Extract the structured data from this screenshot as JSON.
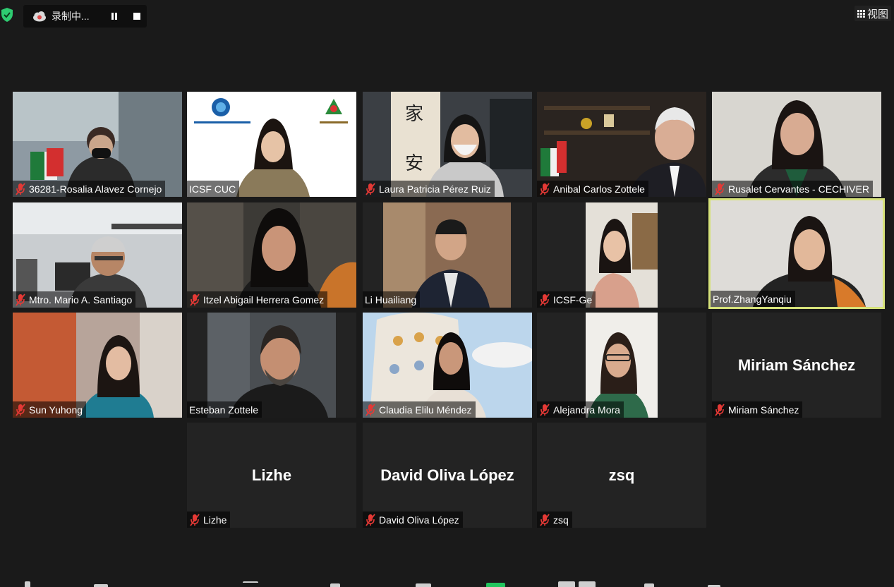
{
  "recording": {
    "label": "录制中...",
    "pause_icon": "pause-icon",
    "stop_icon": "stop-icon"
  },
  "view_button": {
    "label": "视图",
    "icon": "grid-icon"
  },
  "colors": {
    "background": "#1a1a1a",
    "tile": "#232323",
    "active_speaker": "#d6e27a",
    "mic_muted": "#e53935",
    "shield": "#2ecc71"
  },
  "participants": [
    {
      "name": "36281-Rosalia Alavez Cornejo",
      "muted": true
    },
    {
      "name": "ICSF CUC",
      "muted": false
    },
    {
      "name": "Laura Patricia Pérez Ruiz",
      "muted": true
    },
    {
      "name": "Anibal Carlos Zottele",
      "muted": true
    },
    {
      "name": "Rusalet Cervantes - CECHIVER",
      "muted": true
    },
    {
      "name": "Mtro. Mario A. Santiago",
      "muted": true
    },
    {
      "name": "Itzel Abigail Herrera Gomez",
      "muted": true
    },
    {
      "name": "Li Huailiang",
      "muted": false
    },
    {
      "name": "ICSF-Ge",
      "muted": true
    },
    {
      "name": "Prof.ZhangYanqiu",
      "muted": false,
      "active": true
    },
    {
      "name": "Sun Yuhong",
      "muted": true
    },
    {
      "name": "Esteban Zottele",
      "muted": false
    },
    {
      "name": "Claudia Elilu Méndez",
      "muted": true
    },
    {
      "name": "Alejandra Mora",
      "muted": true
    },
    {
      "name": "Miriam Sánchez",
      "muted": true,
      "video_off": true,
      "display": "Miriam Sánchez"
    },
    {
      "name": "Lizhe",
      "muted": true,
      "video_off": true,
      "display": "Lizhe"
    },
    {
      "name": "David Oliva López",
      "muted": true,
      "video_off": true,
      "display": "David Oliva López"
    },
    {
      "name": "zsq",
      "muted": true,
      "video_off": true,
      "display": "zsq"
    }
  ]
}
